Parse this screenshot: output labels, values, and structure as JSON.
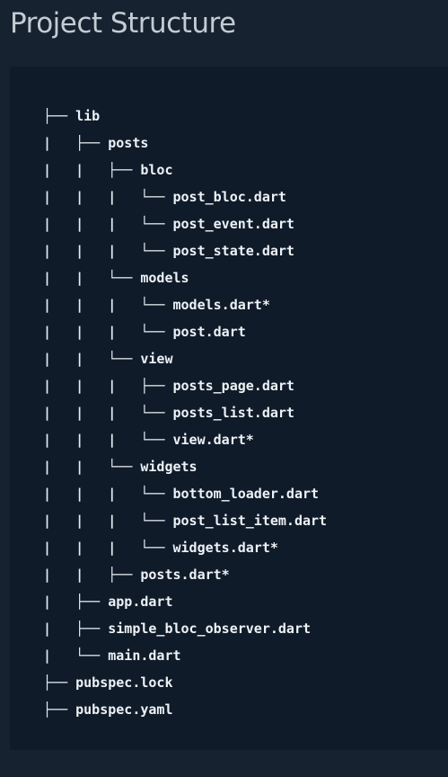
{
  "page": {
    "title": "Project Structure"
  },
  "tree": [
    {
      "prefix": "├── ",
      "name": "lib"
    },
    {
      "prefix": "|   ├── ",
      "name": "posts"
    },
    {
      "prefix": "|   |   ├── ",
      "name": "bloc"
    },
    {
      "prefix": "|   |   |   └── ",
      "name": "post_bloc.dart"
    },
    {
      "prefix": "|   |   |   └── ",
      "name": "post_event.dart"
    },
    {
      "prefix": "|   |   |   └── ",
      "name": "post_state.dart"
    },
    {
      "prefix": "|   |   └── ",
      "name": "models"
    },
    {
      "prefix": "|   |   |   └── ",
      "name": "models.dart*"
    },
    {
      "prefix": "|   |   |   └── ",
      "name": "post.dart"
    },
    {
      "prefix": "|   |   └── ",
      "name": "view"
    },
    {
      "prefix": "|   |   |   ├── ",
      "name": "posts_page.dart"
    },
    {
      "prefix": "|   |   |   └── ",
      "name": "posts_list.dart"
    },
    {
      "prefix": "|   |   |   └── ",
      "name": "view.dart*"
    },
    {
      "prefix": "|   |   └── ",
      "name": "widgets"
    },
    {
      "prefix": "|   |   |   └── ",
      "name": "bottom_loader.dart"
    },
    {
      "prefix": "|   |   |   └── ",
      "name": "post_list_item.dart"
    },
    {
      "prefix": "|   |   |   └── ",
      "name": "widgets.dart*"
    },
    {
      "prefix": "|   |   ├── ",
      "name": "posts.dart*"
    },
    {
      "prefix": "|   ├── ",
      "name": "app.dart"
    },
    {
      "prefix": "|   ├── ",
      "name": "simple_bloc_observer.dart"
    },
    {
      "prefix": "|   └── ",
      "name": "main.dart"
    },
    {
      "prefix": "├── ",
      "name": "pubspec.lock"
    },
    {
      "prefix": "├── ",
      "name": "pubspec.yaml"
    }
  ]
}
